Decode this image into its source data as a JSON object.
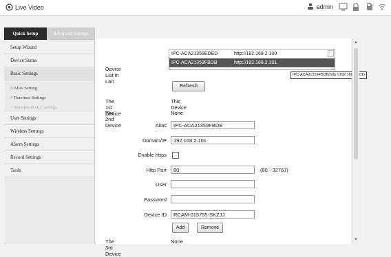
{
  "topbar": {
    "app_title": "Live Video",
    "user": "admin"
  },
  "tabs": {
    "quick": "Quick Setup",
    "advanced": "Advanced Settings"
  },
  "nav": {
    "setup_wizard": "Setup Wizard",
    "device_status": "Device Status",
    "basic_settings": "Basic Settings",
    "sub_alias": "> Alias Setting",
    "sub_datetime": "> Datetime Settings",
    "sub_multiple": "> Multiple device settings",
    "user_settings": "User Settings",
    "wireless_settings": "Wireless Settings",
    "alarm_settings": "Alarm Settings",
    "record_settings": "Record Settings",
    "tools": "Tools"
  },
  "device_list": {
    "label": "Device List in Lan",
    "items": [
      {
        "name": "IPC-ACA21359EDED",
        "url": "http://192.168.2.100"
      },
      {
        "name": "IPC-ACA21359FBDB",
        "url": "http://192.168.2.101"
      }
    ],
    "tooltip": "IPC-ACA21359FBDB(http://192.168.2.101)",
    "refresh": "Refresh"
  },
  "devices": {
    "first_label": "The 1st Device",
    "first_value": "This Device",
    "second_label": "The 2nd Device",
    "second_value": "None",
    "third_label": "The 3rd Device",
    "third_value": "None"
  },
  "form": {
    "alias_label": "Alias",
    "alias_value": "IPC-ACA21359FBDB",
    "domain_label": "Domain/IP",
    "domain_value": "192.168.2.101",
    "https_label": "Enable https",
    "port_label": "Http Port",
    "port_value": "80",
    "port_range": "(80 - 32767)",
    "user_label": "User",
    "user_value": "",
    "password_label": "Password",
    "password_value": "",
    "deviceid_label": "Device ID",
    "deviceid_value": "RCAM-015755-SKZJJ",
    "add": "Add",
    "remove": "Remove"
  }
}
